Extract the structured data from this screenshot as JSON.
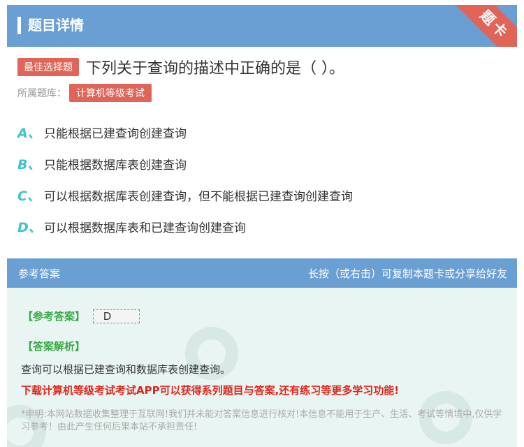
{
  "header": {
    "title": "题目详情",
    "corner_label": "题卡"
  },
  "question": {
    "type_badge": "最佳选择题",
    "text": "下列关于查询的描述中正确的是（   ）。",
    "library_label": "所属题库：",
    "library_name": "计算机等级考试"
  },
  "options": [
    {
      "letter": "A、",
      "text": "只能根据已建查询创建查询"
    },
    {
      "letter": "B、",
      "text": "只能根据数据库表创建查询"
    },
    {
      "letter": "C、",
      "text": "可以根据数据库表创建查询，但不能根据已建查询创建查询"
    },
    {
      "letter": "D、",
      "text": "可以根据数据库表和已建查询创建查询"
    }
  ],
  "answer_panel": {
    "title": "参考答案",
    "hint": "长按（或右击）可复制本题卡或分享给好友",
    "answer_label": "【参考答案】",
    "answer_value": "D",
    "analysis_label": "【答案解析】",
    "analysis_text": "查询可以根据已建查询和数据库表创建查询。",
    "promo": "下载计算机等级考试考试APP可以获得系列题目与答案,还有练习等更多学习功能!",
    "disclaimer": "*申明:本网站数据收集整理于互联网!我们并未能对答案信息进行核对!本信息不能用于生产、生活、考试等情境中,仅供学习参考！由此产生任何后果本站不承担责任!"
  },
  "colors": {
    "header": "#6a9fd3",
    "accent_red": "#e06558",
    "option_letter": "#3cc3d6",
    "green": "#3aaa47"
  }
}
